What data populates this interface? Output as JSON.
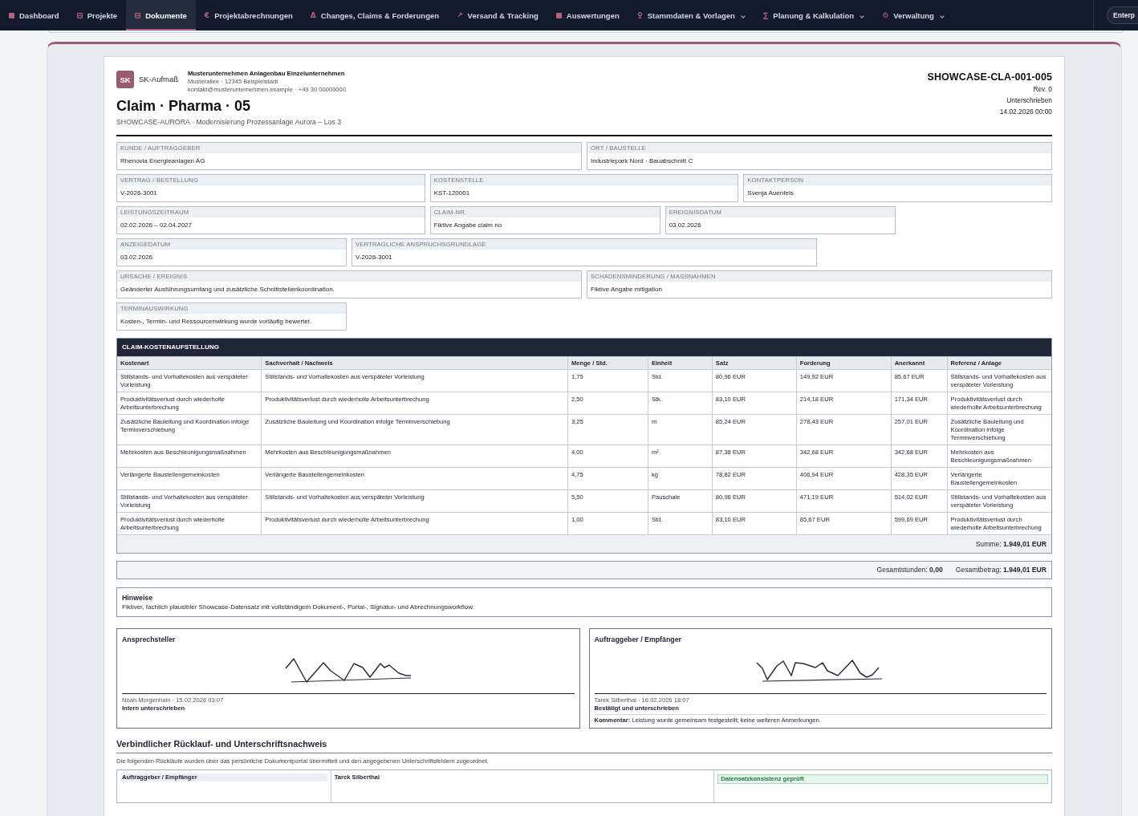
{
  "nav": {
    "items": [
      {
        "label": "Dashboard",
        "selected": false,
        "dropdown": false
      },
      {
        "label": "Projekte",
        "selected": false,
        "dropdown": false
      },
      {
        "label": "Dokumente",
        "selected": true,
        "dropdown": false
      },
      {
        "label": "Projektabrechnungen",
        "icon": "€",
        "selected": false,
        "dropdown": false
      },
      {
        "label": "Changes, Claims & Forderungen",
        "icon": "Δ",
        "selected": false,
        "dropdown": false
      },
      {
        "label": "Versand & Tracking",
        "icon": "↗",
        "selected": false,
        "dropdown": false
      },
      {
        "label": "Auswertungen",
        "selected": false,
        "dropdown": false
      },
      {
        "label": "Stammdaten & Vorlagen",
        "selected": false,
        "dropdown": true
      },
      {
        "label": "Planung & Kalkulation",
        "icon": "∑",
        "selected": false,
        "dropdown": true
      },
      {
        "label": "Verwaltung",
        "icon": "⚙",
        "selected": false,
        "dropdown": true
      }
    ],
    "workspace_button": "Enterp"
  },
  "document": {
    "logo_text": "SK",
    "brand": "SK-Aufmaß",
    "company": {
      "name": "Musterunternehmen Anlagenbau Einzelunternehmen",
      "address": "Musterallee · 12345 Beispielstadt",
      "contact": "kontakt@musterunternehmen.example · +49 30 00000000"
    },
    "title": "Claim · Pharma · 05",
    "subtitle": "SHOWCASE-AURORA · Modernisierung Prozessanlage Aurora – Los 3",
    "number": "SHOWCASE-CLA-001-005",
    "revision": "Rev. 0",
    "status": "Unterschrieben",
    "date": "14.02.2026 00:00"
  },
  "fields": [
    {
      "label": "KUNDE / AUFTRAGGEBER",
      "value": "Rhenovia Energieanlagen AG"
    },
    {
      "label": "ORT / BAUSTELLE",
      "value": "Industriepark Nord · Bauabschnitt C"
    },
    {
      "label": "VERTRAG / BESTELLUNG",
      "value": "V-2026-3001"
    },
    {
      "label": "KOSTENSTELLE",
      "value": "KST-120001"
    },
    {
      "label": "KONTAKTPERSON",
      "value": "Svenja Auenfels"
    },
    {
      "label": "LEISTUNGSZEITRAUM",
      "value": "02.02.2026 – 02.04.2027"
    },
    {
      "label": "CLAIM-NR.",
      "value": "Fiktive Angabe claim no"
    },
    {
      "label": "EREIGNISDATUM",
      "value": "03.02.2026"
    },
    {
      "label": "ANZEIGEDATUM",
      "value": "03.02.2026"
    },
    {
      "label": "VERTRAGLICHE ANSPRUCHSGRUNDLAGE",
      "value": "V-2026-3001"
    },
    {
      "label": "URSACHE / EREIGNIS",
      "value": "Geänderter Ausführungsumfang und zusätzliche Schnittstellenkoordination."
    },
    {
      "label": "SCHADENSMINDERUNG / MASSNAHMEN",
      "value": "Fiktive Angabe mitigation"
    },
    {
      "label": "TERMINAUSWIRKUNG",
      "value": "Kosten-, Termin- und Ressourcenwirkung wurde vorläufig bewertet."
    }
  ],
  "cost_table": {
    "title": "CLAIM-KOSTENAUFSTELLUNG",
    "columns": [
      "Kostenart",
      "Sachverhalt / Nachweis",
      "Menge / Std.",
      "Einheit",
      "Satz",
      "Forderung",
      "Anerkannt",
      "Referenz / Anlage"
    ],
    "rows": [
      [
        "Stillstands- und Vorhaltekosten aus verspäteter Vorleistung",
        "Stillstands- und Vorhaltekosten aus verspäteter Vorleistung",
        "1,75",
        "Std.",
        "80,96 EUR",
        "149,92 EUR",
        "85,67 EUR",
        "Stillstands- und Vorhaltekosten aus verspäteter Vorleistung"
      ],
      [
        "Produktivitätsverlust durch wiederholte Arbeitsunterbrechung",
        "Produktivitätsverlust durch wiederholte Arbeitsunterbrechung",
        "2,50",
        "Stk.",
        "83,10 EUR",
        "214,18 EUR",
        "171,34 EUR",
        "Produktivitätsverlust durch wiederholte Arbeitsunterbrechung"
      ],
      [
        "Zusätzliche Bauleitung und Koordination infolge Terminverschiebung",
        "Zusätzliche Bauleitung und Koordination infolge Terminverschiebung",
        "3,25",
        "m",
        "85,24 EUR",
        "278,43 EUR",
        "257,01 EUR",
        "Zusätzliche Bauleitung und Koordination infolge Terminverschiebung"
      ],
      [
        "Mehrkosten aus Beschleunigungsmaßnahmen",
        "Mehrkosten aus Beschleunigungsmaßnahmen",
        "4,00",
        "m²",
        "87,38 EUR",
        "342,68 EUR",
        "342,68 EUR",
        "Mehrkosten aus Beschleunigungsmaßnahmen"
      ],
      [
        "Verlängerte Baustellengemeinkosten",
        "Verlängerte Baustellengemeinkosten",
        "4,75",
        "kg",
        "78,82 EUR",
        "406,94 EUR",
        "428,35 EUR",
        "Verlängerte Baustellengemeinkosten"
      ],
      [
        "Stillstands- und Vorhaltekosten aus verspäteter Vorleistung",
        "Stillstands- und Vorhaltekosten aus verspäteter Vorleistung",
        "5,50",
        "Pauschale",
        "80,96 EUR",
        "471,19 EUR",
        "514,02 EUR",
        "Stillstands- und Vorhaltekosten aus verspäteter Vorleistung"
      ],
      [
        "Produktivitätsverlust durch wiederholte Arbeitsunterbrechung",
        "Produktivitätsverlust durch wiederholte Arbeitsunterbrechung",
        "1,00",
        "Std.",
        "83,10 EUR",
        "85,67 EUR",
        "599,69 EUR",
        "Produktivitätsverlust durch wiederholte Arbeitsunterbrechung"
      ]
    ],
    "sum": "Summe: **1.949,01 EUR**"
  },
  "totals": [
    "Gesamtstunden: **0,00**",
    "Gesamtbetrag: **1.949,01 EUR**"
  ],
  "notes": {
    "title": "Hinweise",
    "text": "Fiktiver, fachlich plausibler Showcase-Datensatz mit vollständigem Dokument-, Portal-, Signatur- und Abrechnungsworkflow."
  },
  "signatures": [
    {
      "title": "Ansprechsteller",
      "signer": "Noah Morgenhain · 15.02.2026 03:07",
      "status": "Intern unterschrieben"
    },
    {
      "title": "Auftraggeber / Empfänger",
      "signer": "Tarek Silberthal · 16.02.2026 18:07",
      "status": "Bestätigt und unterschrieben",
      "comment": "**Kommentar:** Leistung wurde gemeinsam festgestellt; keine weiteren Anmerkungen."
    }
  ],
  "return_section": {
    "title": "Verbindlicher Rücklauf- und Unterschriftsnachweis",
    "text": "Die folgenden Rückläufe wurden über das persönliche Dokumentportal übermittelt und den angegebenen Unterschriftsfeldern zugeordnet.",
    "role": "Auftraggeber / Empfänger",
    "name": "Tarek Silberthal",
    "check": "Datensatzkonsistenz geprüft"
  }
}
